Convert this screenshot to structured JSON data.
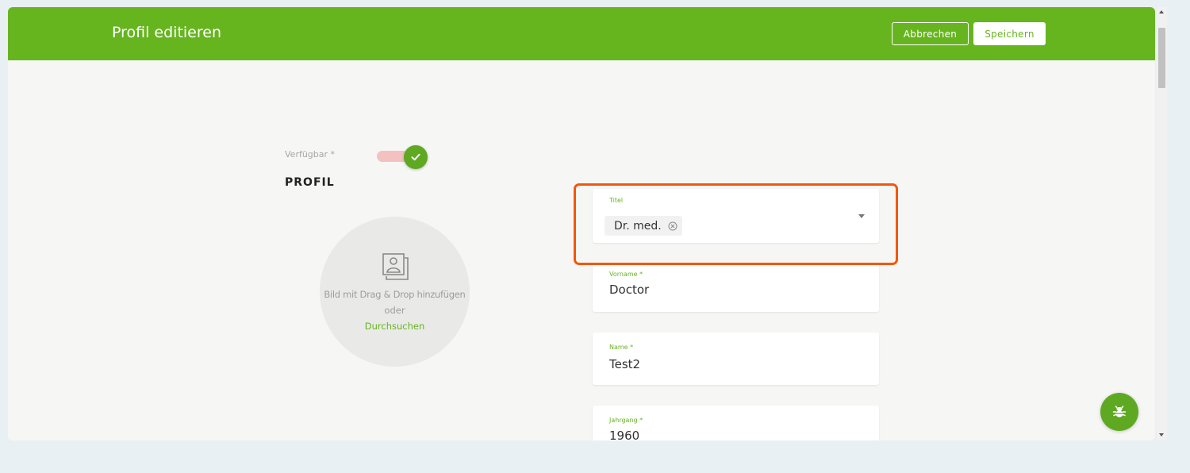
{
  "header": {
    "title": "Profil editieren",
    "cancel_label": "Abbrechen",
    "save_label": "Speichern"
  },
  "availability": {
    "label": "Verfügbar *",
    "enabled": true
  },
  "profile": {
    "heading": "PROFIL",
    "image_drop": {
      "text": "Bild mit Drag & Drop hinzufügen",
      "or": "oder",
      "browse": "Durchsuchen"
    }
  },
  "fields": {
    "titel": {
      "label": "Titel",
      "chip": "Dr. med."
    },
    "vorname": {
      "label": "Vorname *",
      "value": "Doctor"
    },
    "name": {
      "label": "Name *",
      "value": "Test2"
    },
    "jahrgang": {
      "label": "Jahrgang *",
      "value": "1960"
    }
  },
  "icons": {
    "toggle_check": "check-icon",
    "image_placeholder": "image-placeholder-icon",
    "chip_remove": "remove-circle-icon",
    "dropdown": "caret-down-icon",
    "bug": "bug-icon"
  },
  "colors": {
    "brand_green": "#66b51f",
    "highlight_orange": "#f4570b",
    "toggle_track": "#f4c1c1"
  }
}
